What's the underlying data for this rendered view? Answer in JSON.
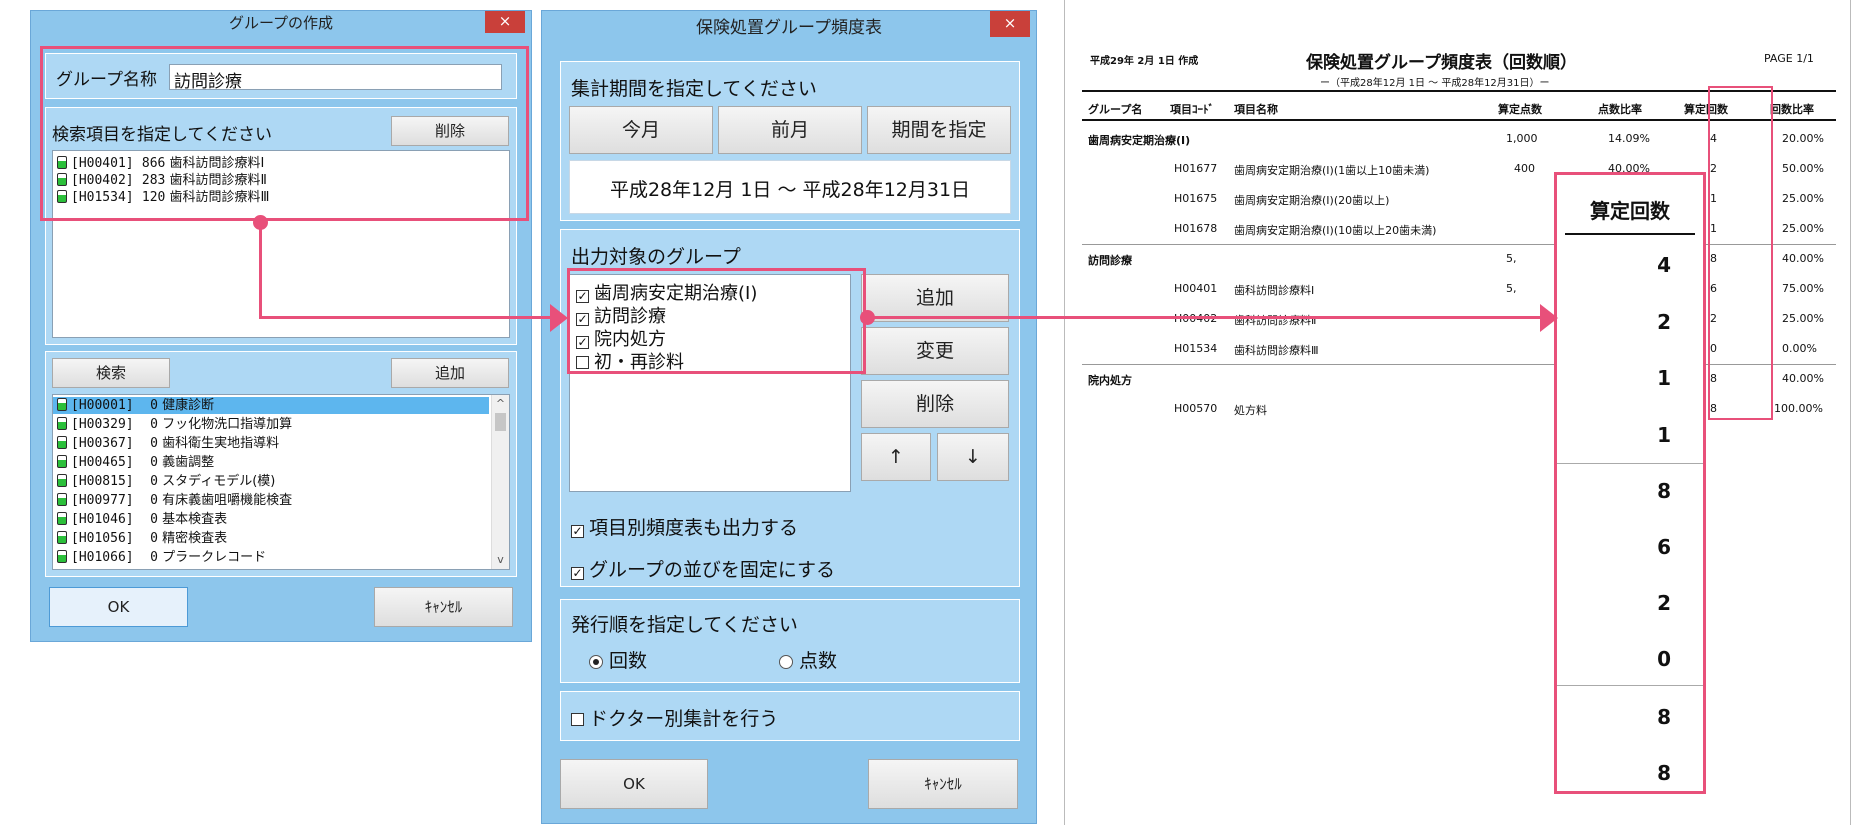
{
  "group_create": {
    "title": "グループの作成",
    "close_glyph": "×",
    "name_label": "グループ名称",
    "name_value": "訪問診療",
    "search_items_label": "検索項目を指定してください",
    "delete_label": "削除",
    "selected_items": [
      {
        "code": "[H00401]",
        "count": "866",
        "name": "歯科訪問診療料Ⅰ"
      },
      {
        "code": "[H00402]",
        "count": "283",
        "name": "歯科訪問診療料Ⅱ"
      },
      {
        "code": "[H01534]",
        "count": "120",
        "name": "歯科訪問診療料Ⅲ"
      }
    ],
    "search_label": "検索",
    "add_label": "追加",
    "search_results": [
      {
        "code": "[H00001]",
        "count": "0",
        "name": "健康診断"
      },
      {
        "code": "[H00329]",
        "count": "0",
        "name": "フッ化物洗口指導加算"
      },
      {
        "code": "[H00367]",
        "count": "0",
        "name": "歯科衛生実地指導料"
      },
      {
        "code": "[H00465]",
        "count": "0",
        "name": "義歯調整"
      },
      {
        "code": "[H00815]",
        "count": "0",
        "name": "スタディモデル(模)"
      },
      {
        "code": "[H00977]",
        "count": "0",
        "name": "有床義歯咀嚼機能検査"
      },
      {
        "code": "[H01046]",
        "count": "0",
        "name": "基本検査表"
      },
      {
        "code": "[H01056]",
        "count": "0",
        "name": "精密検査表"
      },
      {
        "code": "[H01066]",
        "count": "0",
        "name": "プラークレコード"
      }
    ],
    "ok_label": "OK",
    "cancel_label": "ｷｬﾝｾﾙ",
    "scroll_up": "^",
    "scroll_down": "v"
  },
  "freq_dialog": {
    "title": "保険処置グループ頻度表",
    "close_glyph": "×",
    "period_label": "集計期間を指定してください",
    "period_buttons": [
      "今月",
      "前月",
      "期間を指定"
    ],
    "period_text": "平成28年12月 1日 ～ 平成28年12月31日",
    "groups_label": "出力対象のグループ",
    "groups": [
      {
        "name": "歯周病安定期治療(Ⅰ)",
        "mark": "✓"
      },
      {
        "name": "訪問診療",
        "mark": "✓"
      },
      {
        "name": "院内処方",
        "mark": "✓"
      },
      {
        "name": "初・再診料",
        "mark": ""
      }
    ],
    "add_label": "追加",
    "change_label": "変更",
    "delete_label": "削除",
    "up_glyph": "↑",
    "down_glyph": "↓",
    "opt_item_freq": "項目別頻度表も出力する",
    "opt_fix_order": "グループの並びを固定にする",
    "order_label": "発行順を指定してください",
    "order_count": "回数",
    "order_points": "点数",
    "doctor_label": "ドクター別集計を行う",
    "ok_label": "OK",
    "cancel_label": "ｷｬﾝｾﾙ",
    "check_mark": "✓"
  },
  "report": {
    "created": "平成29年 2月 1日 作成",
    "title": "保険処置グループ頻度表（回数順）",
    "subtitle": "ー（平成28年12月 1日 〜 平成28年12月31日）ー",
    "page": "PAGE 1/1",
    "headers": {
      "group": "グループ名",
      "code": "項目ｺｰﾄﾞ",
      "name": "項目名称",
      "points": "算定点数",
      "point_ratio": "点数比率",
      "count": "算定回数",
      "count_ratio": "回数比率"
    },
    "rows": [
      {
        "group": "歯周病安定期治療(Ⅰ)",
        "code": "",
        "name": "",
        "points": "1,000",
        "point_ratio": "14.09%",
        "count": "4",
        "count_ratio": "20.00%"
      },
      {
        "group": "",
        "code": "H01677",
        "name": "歯周病安定期治療(Ⅰ)(1歯以上10歯未満)",
        "points": "400",
        "point_ratio": "40.00%",
        "count": "2",
        "count_ratio": "50.00%"
      },
      {
        "group": "",
        "code": "H01675",
        "name": "歯周病安定期治療(Ⅰ)(20歯以上)",
        "points": "",
        "point_ratio": "",
        "count": "1",
        "count_ratio": "25.00%"
      },
      {
        "group": "",
        "code": "H01678",
        "name": "歯周病安定期治療(Ⅰ)(10歯以上20歯未満)",
        "points": "",
        "point_ratio": "",
        "count": "1",
        "count_ratio": "25.00%"
      },
      {
        "group": "訪問診療",
        "code": "",
        "name": "",
        "points": "5,",
        "point_ratio": "",
        "count": "8",
        "count_ratio": "40.00%"
      },
      {
        "group": "",
        "code": "H00401",
        "name": "歯科訪問診療料Ⅰ",
        "points": "5,",
        "point_ratio": "",
        "count": "6",
        "count_ratio": "75.00%"
      },
      {
        "group": "",
        "code": "H00402",
        "name": "歯科訪問診療料Ⅱ",
        "points": "",
        "point_ratio": "",
        "count": "2",
        "count_ratio": "25.00%"
      },
      {
        "group": "",
        "code": "H01534",
        "name": "歯科訪問診療料Ⅲ",
        "points": "",
        "point_ratio": "",
        "count": "0",
        "count_ratio": "0.00%"
      },
      {
        "group": "院内処方",
        "code": "",
        "name": "",
        "points": "",
        "point_ratio": "",
        "count": "8",
        "count_ratio": "40.00%"
      },
      {
        "group": "",
        "code": "H00570",
        "name": "処方料",
        "points": "",
        "point_ratio": "",
        "count": "8",
        "count_ratio": "100.00%"
      }
    ],
    "zoom_header": "算定回数",
    "zoom_values": [
      "4",
      "2",
      "1",
      "1",
      "8",
      "6",
      "2",
      "0",
      "8",
      "8"
    ]
  },
  "colors": {
    "accent": "#e8507a",
    "window": "#8dc6ec",
    "panel": "#aed8f4",
    "close": "#c9403a"
  }
}
